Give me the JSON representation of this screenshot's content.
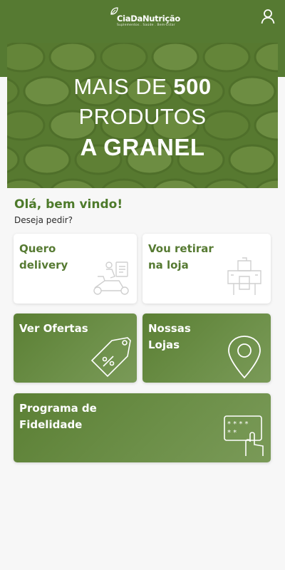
{
  "header": {
    "brand_name": "CiaDaNutrição",
    "brand_tagline": "Suplementos . Saúde . Bem-Estar",
    "header_color": "#567a32"
  },
  "banner": {
    "line1_prefix": "MAIS DE ",
    "line1_number": "500",
    "line2": "PRODUTOS",
    "line3": "A GRANEL"
  },
  "greeting": {
    "title": "Olá, bem vindo!",
    "subtitle": "Deseja pedir?"
  },
  "cards": {
    "delivery": {
      "label": "Quero\ndelivery",
      "icon": "scooter-icon"
    },
    "pickup": {
      "label": "Vou retirar\nna loja",
      "icon": "store-pickup-icon"
    },
    "offers": {
      "label": "Ver Ofertas",
      "icon": "price-tag-icon"
    },
    "stores": {
      "label": "Nossas\nLojas",
      "icon": "map-pin-icon"
    },
    "loyalty": {
      "label": "Programa de\nFidelidade",
      "icon": "card-hand-icon"
    }
  },
  "colors": {
    "brand_green": "#567a32",
    "accent_text_green": "#4d7a2a",
    "background": "#f7f7f7"
  }
}
